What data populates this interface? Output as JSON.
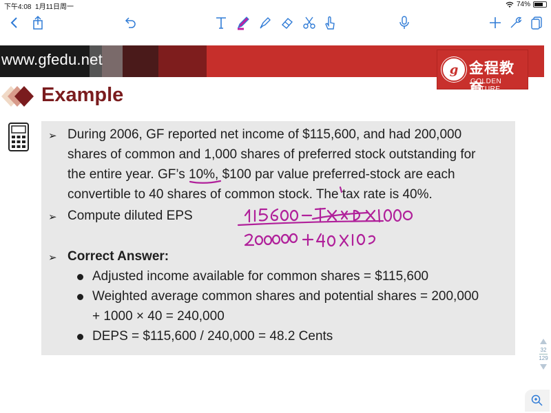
{
  "status_bar": {
    "time": "下午4:08",
    "date": "1月11日周一",
    "battery": "74%",
    "battery_level": 0.74
  },
  "toolbar": {
    "left_icons": [
      "back-chevron-icon",
      "share-icon",
      "undo-icon"
    ],
    "center_icons": [
      "text-tool-icon",
      "pen-tool-icon",
      "highlighter-icon",
      "eraser-icon",
      "lasso-scissors-icon",
      "hand-pointer-icon"
    ],
    "right_icons": [
      "microphone-icon",
      "plus-icon",
      "wrench-icon",
      "pages-icon"
    ],
    "pen_color": "#c020a0"
  },
  "slide": {
    "banner_url": "www.gfedu.net",
    "logo_cn": "金程教育",
    "logo_en": "GOLDEN FUTURE",
    "title": "Example",
    "accent_color": "#7a1c1e",
    "banner_color": "#c62f2b",
    "bullets": [
      "During 2006, GF reported net income of $115,600, and had 200,000",
      "shares of common and 1,000 shares of preferred stock outstanding for",
      "the entire year. GF’s 10%, $100 par value preferred-stock are each",
      "convertible to 40 shares of common stock. The tax rate is 40%."
    ],
    "bullet2": "Compute diluted EPS",
    "answer_heading": "Correct Answer:",
    "answers": [
      "Adjusted income available for common shares = $115,600",
      "Weighted average common shares and potential shares = 200,000",
      "+ 1000 × 40 = 240,000",
      "DEPS = $115,600 / 240,000 = 48.2 Cents"
    ]
  },
  "handwriting": {
    "line1": "115600 − 1̶0̶%̶×̶1̶0̶0̶ ×1000",
    "line2": "200000 + 40 × 1000",
    "color": "#b0209a"
  },
  "pager": {
    "current": "32",
    "total": "129"
  }
}
